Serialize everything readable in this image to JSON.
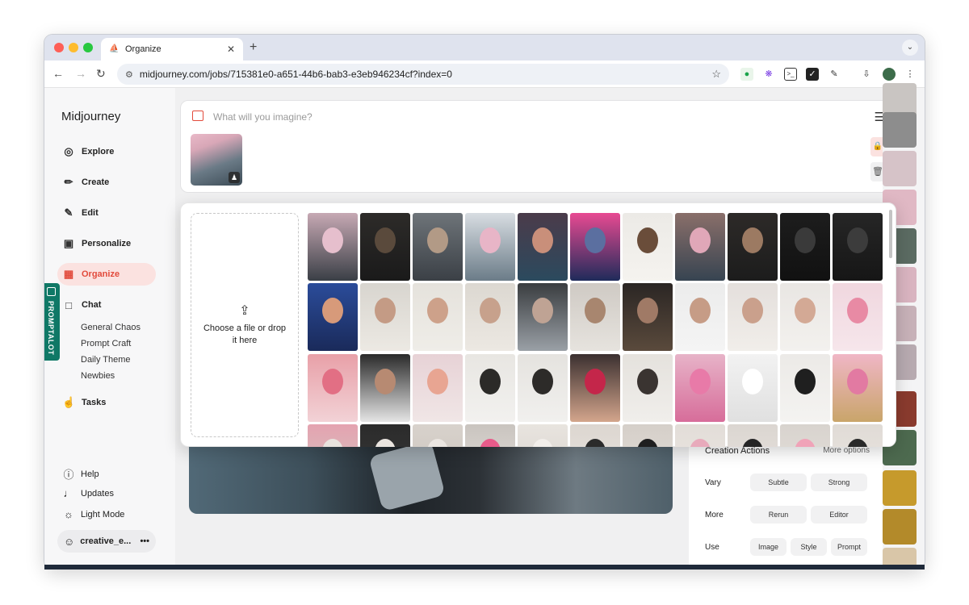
{
  "browser": {
    "tab_title": "Organize",
    "new_tab_symbol": "+",
    "url": "midjourney.com/jobs/715381e0-a651-44b6-bab3-e3eb946234cf?index=0"
  },
  "sidebar": {
    "brand": "Midjourney",
    "items": [
      {
        "label": "Explore",
        "icon": "compass-icon"
      },
      {
        "label": "Create",
        "icon": "brush-icon"
      },
      {
        "label": "Edit",
        "icon": "edit-icon"
      },
      {
        "label": "Personalize",
        "icon": "personalize-icon"
      },
      {
        "label": "Organize",
        "icon": "image-icon"
      },
      {
        "label": "Chat",
        "icon": "chat-icon"
      }
    ],
    "chat_channels": [
      "General Chaos",
      "Prompt Craft",
      "Daily Theme",
      "Newbies"
    ],
    "tasks": "Tasks",
    "bottom": [
      {
        "label": "Help",
        "icon": "help-icon"
      },
      {
        "label": "Updates",
        "icon": "bell-icon"
      },
      {
        "label": "Light Mode",
        "icon": "sun-icon"
      }
    ],
    "user": "creative_e...",
    "user_menu": "•••",
    "promptalot": "PROMPTALOT"
  },
  "prompt": {
    "placeholder": "What will you imagine?"
  },
  "upload": {
    "text": "Choose a file or drop it here"
  },
  "actions": {
    "title": "Creation Actions",
    "more_options": "More options",
    "rows": [
      {
        "label": "Vary",
        "buttons": [
          "Subtle",
          "Strong"
        ]
      },
      {
        "label": "More",
        "buttons": [
          "Rerun",
          "Editor"
        ]
      },
      {
        "label": "Use",
        "buttons": [
          "Image",
          "Style",
          "Prompt"
        ]
      }
    ]
  },
  "colors": {
    "accent": "#e24a3b",
    "active_bg": "#fbe2e0",
    "promptalot": "#0f7866"
  }
}
